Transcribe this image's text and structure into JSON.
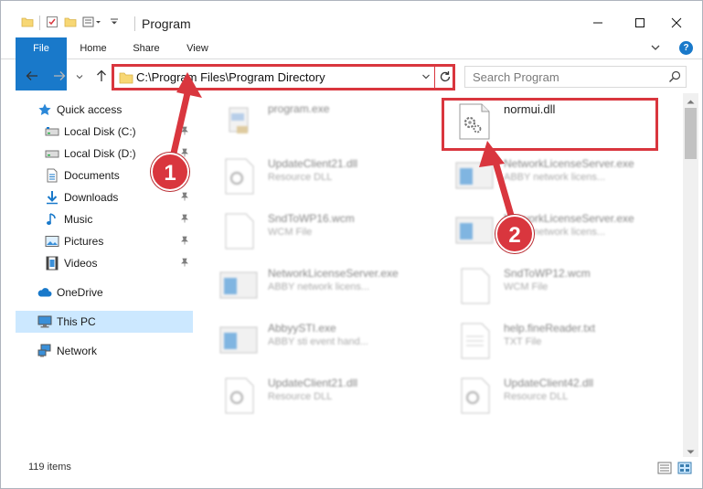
{
  "window": {
    "title": "Program",
    "colors": {
      "accent": "#1979ca",
      "annotation": "#d9363e",
      "selection": "#cce8ff"
    }
  },
  "ribbon": {
    "tabs": [
      {
        "label": "File",
        "icon": ""
      },
      {
        "label": "Home"
      },
      {
        "label": "Share"
      },
      {
        "label": "View"
      }
    ],
    "help_icon": "?"
  },
  "navbar": {
    "address_path": "C:\\Program Files\\Program Directory",
    "search_placeholder": "Search Program"
  },
  "navpane": {
    "items": [
      {
        "label": "Quick access",
        "icon": "star-icon",
        "pinned": false
      },
      {
        "label": "Local Disk (C:)",
        "icon": "drive-icon",
        "pinned": true
      },
      {
        "label": "Local Disk (D:)",
        "icon": "drive-icon",
        "pinned": true
      },
      {
        "label": "Documents",
        "icon": "documents-icon",
        "pinned": true
      },
      {
        "label": "Downloads",
        "icon": "download-icon",
        "pinned": true
      },
      {
        "label": "Music",
        "icon": "music-icon",
        "pinned": true
      },
      {
        "label": "Pictures",
        "icon": "pictures-icon",
        "pinned": true
      },
      {
        "label": "Videos",
        "icon": "videos-icon",
        "pinned": true
      },
      {
        "label": "OneDrive",
        "icon": "cloud-icon",
        "pinned": false
      },
      {
        "label": "This PC",
        "icon": "computer-icon",
        "pinned": false,
        "selected": true
      },
      {
        "label": "Network",
        "icon": "network-icon",
        "pinned": false
      }
    ]
  },
  "files": [
    {
      "name": "program.exe",
      "type": "",
      "icon": "program-icon",
      "highlighted": false
    },
    {
      "name": "normui.dll",
      "type": "",
      "icon": "dll-gear-icon",
      "highlighted": true
    },
    {
      "name": "UpdateClient21.dll",
      "type": "Resource DLL",
      "icon": "dll-gear-icon"
    },
    {
      "name": "NetworkLicenseServer.exe",
      "type": "ABBY network licens...",
      "icon": "app-window-icon"
    },
    {
      "name": "SndToWP16.wcm",
      "type": "WCM File",
      "icon": "blank-file-icon"
    },
    {
      "name": "NetworkLicenseServer.exe",
      "type": "ABBY network licens...",
      "icon": "app-window-icon"
    },
    {
      "name": "NetworkLicenseServer.exe",
      "type": "ABBY network licens...",
      "icon": "app-window-icon"
    },
    {
      "name": "SndToWP12.wcm",
      "type": "WCM File",
      "icon": "blank-file-icon"
    },
    {
      "name": "AbbyySTI.exe",
      "type": "ABBY sti event hand...",
      "icon": "app-window-icon"
    },
    {
      "name": "help.fineReader.txt",
      "type": "TXT File",
      "icon": "text-file-icon"
    },
    {
      "name": "UpdateClient21.dll",
      "type": "Resource DLL",
      "icon": "dll-gear-icon"
    },
    {
      "name": "UpdateClient42.dll",
      "type": "Resource DLL",
      "icon": "dll-gear-icon"
    }
  ],
  "status": {
    "item_count": "119 items"
  },
  "callouts": {
    "one": "1",
    "two": "2"
  }
}
